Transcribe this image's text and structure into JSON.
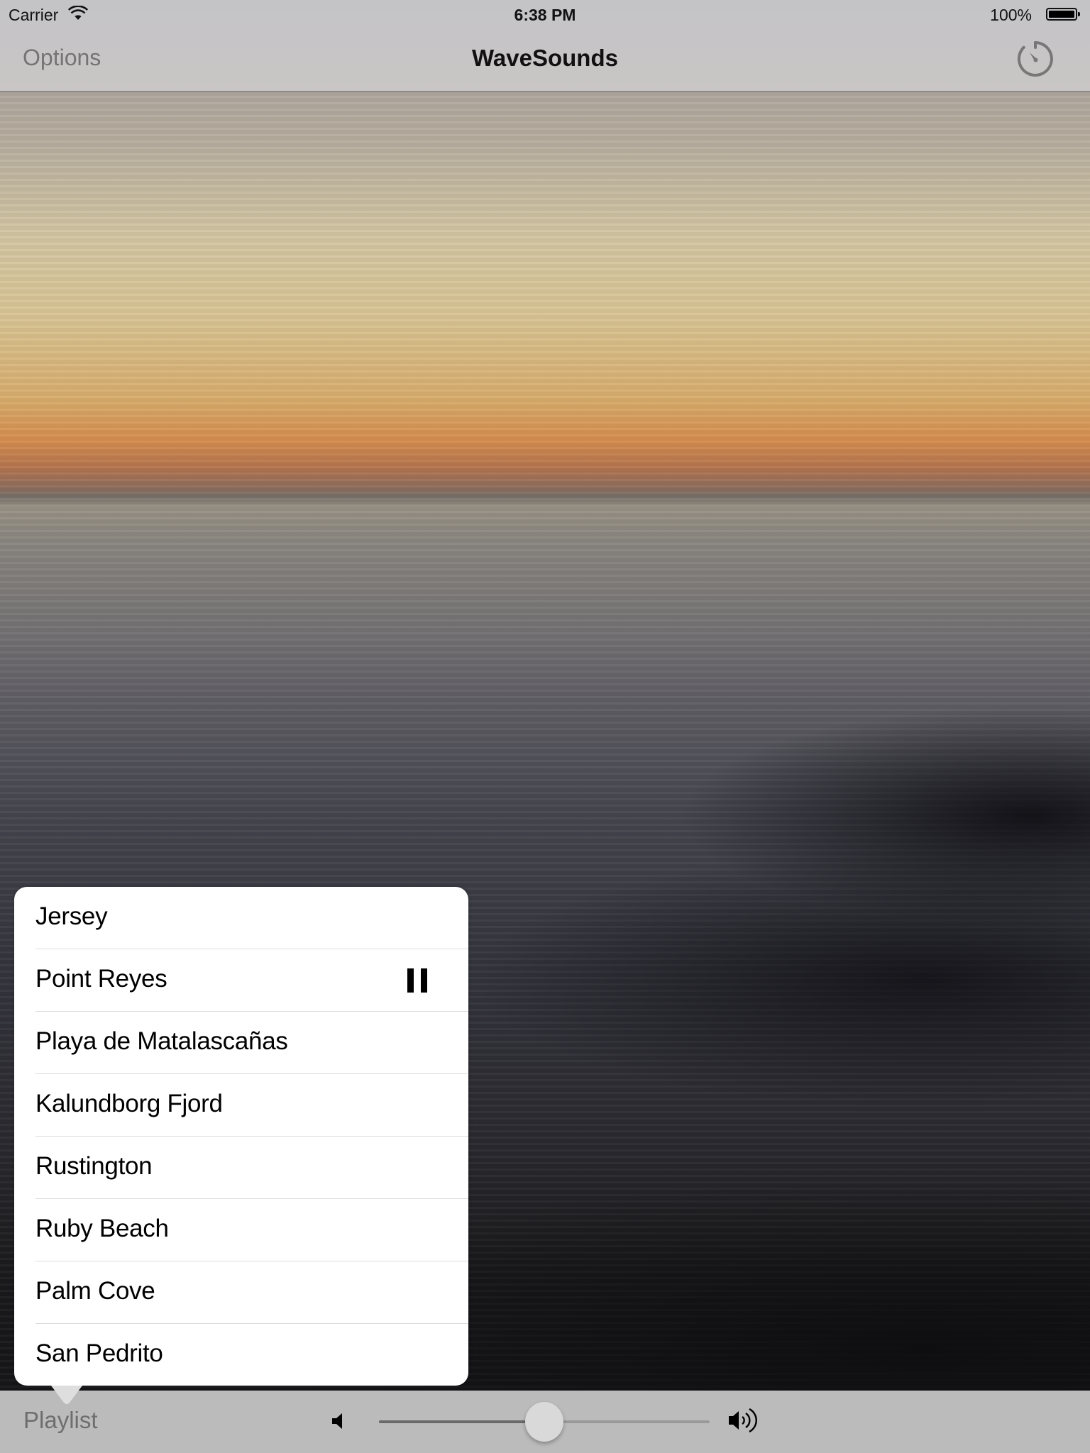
{
  "status_bar": {
    "carrier": "Carrier",
    "wifi_icon": "wifi-icon",
    "time": "6:38 PM",
    "battery_percent": "100%",
    "battery_icon": "battery-icon"
  },
  "nav_bar": {
    "left_button": "Options",
    "title": "WaveSounds",
    "right_icon": "sleep-timer-icon"
  },
  "playlist_popover": {
    "items": [
      {
        "label": "Jersey",
        "playing": false
      },
      {
        "label": "Point Reyes",
        "playing": true,
        "icon": "pause-icon"
      },
      {
        "label": "Playa de Matalascañas",
        "playing": false
      },
      {
        "label": "Kalundborg Fjord",
        "playing": false
      },
      {
        "label": "Rustington",
        "playing": false
      },
      {
        "label": "Ruby Beach",
        "playing": false
      },
      {
        "label": "Palm Cove",
        "playing": false
      },
      {
        "label": "San Pedrito",
        "playing": false
      }
    ]
  },
  "toolbar": {
    "playlist_button": "Playlist",
    "volume_min_icon": "speaker-low-icon",
    "volume_max_icon": "speaker-high-icon",
    "volume_level": 0.5
  },
  "colors": {
    "nav_bar_bg": "#c6c4c6",
    "nav_button_text": "#747474",
    "toolbar_bg": "#bbbbbb",
    "slider_thumb": "#d9d9d9"
  }
}
